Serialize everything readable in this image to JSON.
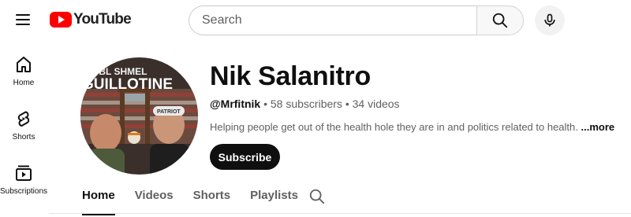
{
  "brand": {
    "logo_text": "YouTube",
    "accent": "#ff0000"
  },
  "search": {
    "placeholder": "Search",
    "value": ""
  },
  "sidebar": {
    "items": [
      {
        "label": "Home",
        "icon": "home-icon"
      },
      {
        "label": "Shorts",
        "icon": "shorts-icon"
      },
      {
        "label": "Subscriptions",
        "icon": "subscriptions-icon"
      }
    ]
  },
  "channel": {
    "name": "Nik Salanitro",
    "handle": "@Mrfitnik",
    "separator": "•",
    "subscribers": "58 subscribers",
    "videos": "34 videos",
    "description": "Helping people get out of the health hole they are in and politics related to health.",
    "more_label": "...more",
    "subscribe_label": "Subscribe",
    "avatar_text_top": "ABBL SHMEL",
    "avatar_text_main": "GUILLOTINE",
    "avatar_cap_text": "PATRIOT"
  },
  "tabs": [
    {
      "label": "Home",
      "active": true
    },
    {
      "label": "Videos",
      "active": false
    },
    {
      "label": "Shorts",
      "active": false
    },
    {
      "label": "Playlists",
      "active": false
    }
  ]
}
